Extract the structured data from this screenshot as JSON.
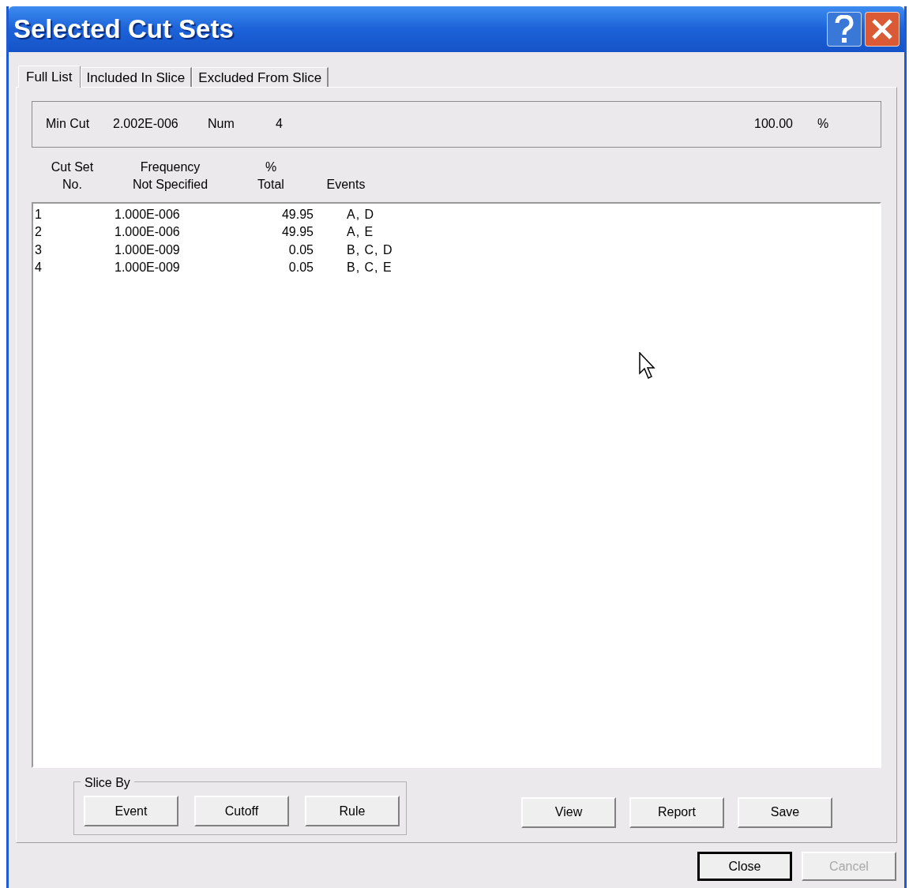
{
  "window": {
    "title": "Selected Cut Sets"
  },
  "tabs": [
    {
      "label": "Full List",
      "selected": true
    },
    {
      "label": "Included In Slice",
      "selected": false
    },
    {
      "label": "Excluded From Slice",
      "selected": false
    }
  ],
  "summary": {
    "min_cut_label": "Min Cut",
    "min_cut": "2.002E-006",
    "num_label": "Num",
    "num": "4",
    "percent": "100.00",
    "percent_unit": "%"
  },
  "columns": [
    {
      "line1": "Cut Set",
      "line2": "No."
    },
    {
      "line1": "Frequency",
      "line2": "Not Specified"
    },
    {
      "line1": "%",
      "line2": "Total"
    },
    {
      "line2": "Events"
    }
  ],
  "rows": [
    {
      "no": "1",
      "frequency": "1.000E-006",
      "total": "49.95",
      "events": "A, D"
    },
    {
      "no": "2",
      "frequency": "1.000E-006",
      "total": "49.95",
      "events": "A, E"
    },
    {
      "no": "3",
      "frequency": "1.000E-009",
      "total": "0.05",
      "events": "B, C, D"
    },
    {
      "no": "4",
      "frequency": "1.000E-009",
      "total": "0.05",
      "events": "B, C, E"
    }
  ],
  "slice_by": {
    "label": "Slice By",
    "buttons": [
      "Event",
      "Cutoff",
      "Rule"
    ]
  },
  "actions": [
    "View",
    "Report",
    "Save"
  ],
  "dialog_buttons": [
    {
      "label": "Close",
      "disabled": false,
      "default": true
    },
    {
      "label": "Cancel",
      "disabled": true,
      "default": false
    }
  ]
}
